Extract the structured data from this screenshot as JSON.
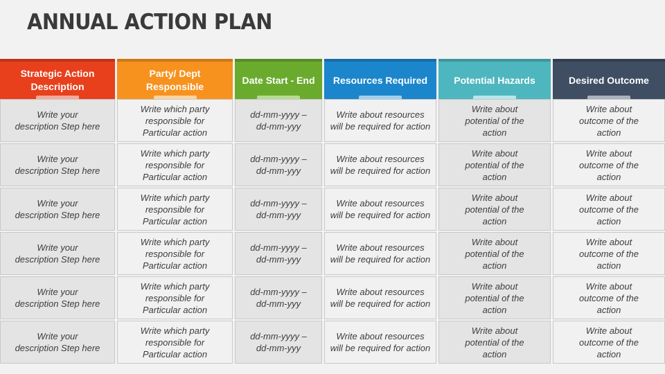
{
  "title": "ANNUAL ACTION PLAN",
  "columns": [
    {
      "label": "Strategic Action\nDescription",
      "color": "#e8401c",
      "tab": "#f5a99a"
    },
    {
      "label": "Party/ Dept\nResponsible",
      "color": "#f7921e",
      "tab": "#fcd3a0"
    },
    {
      "label": "Date Start - End",
      "color": "#6aab2e",
      "tab": "#b5dc8f"
    },
    {
      "label": "Resources Required",
      "color": "#1b86cc",
      "tab": "#9fd0f0"
    },
    {
      "label": "Potential Hazards",
      "color": "#4db6bf",
      "tab": "#b8e6ea"
    },
    {
      "label": "Desired Outcome",
      "color": "#3f4e63",
      "tab": "#a9b1bd"
    }
  ],
  "rows": [
    [
      "Write your\ndescription Step here",
      "Write which party\nresponsible for\nParticular  action",
      "dd-mm-yyyy –\ndd-mm-yyy",
      "Write about resources\nwill be required for action",
      "Write about\npotential of the\naction",
      "Write about\noutcome of  the\naction"
    ],
    [
      "Write your\ndescription Step here",
      "Write which party\nresponsible for\nParticular  action",
      "dd-mm-yyyy –\ndd-mm-yyy",
      "Write about resources\nwill be required for action",
      "Write about\npotential of the\naction",
      "Write about\noutcome of  the\naction"
    ],
    [
      "Write your\ndescription Step here",
      "Write which party\nresponsible for\nParticular  action",
      "dd-mm-yyyy –\ndd-mm-yyy",
      "Write about resources\nwill be required for action",
      "Write about\npotential of the\naction",
      "Write about\noutcome of  the\naction"
    ],
    [
      "Write your\ndescription Step here",
      "Write which party\nresponsible for\nParticular  action",
      "dd-mm-yyyy –\ndd-mm-yyy",
      "Write about resources\nwill be required for action",
      "Write about\npotential of the\naction",
      "Write about\noutcome of  the\naction"
    ],
    [
      "Write your\ndescription Step here",
      "Write which party\nresponsible for\nParticular  action",
      "dd-mm-yyyy –\ndd-mm-yyy",
      "Write about resources\nwill be required for action",
      "Write about\npotential of the\naction",
      "Write about\noutcome of  the\naction"
    ],
    [
      "Write your\ndescription Step here",
      "Write which party\nresponsible for\nParticular  action",
      "dd-mm-yyyy –\ndd-mm-yyy",
      "Write about resources\nwill be required for action",
      "Write about\npotential of the\naction",
      "Write about\noutcome of  the\naction"
    ]
  ]
}
